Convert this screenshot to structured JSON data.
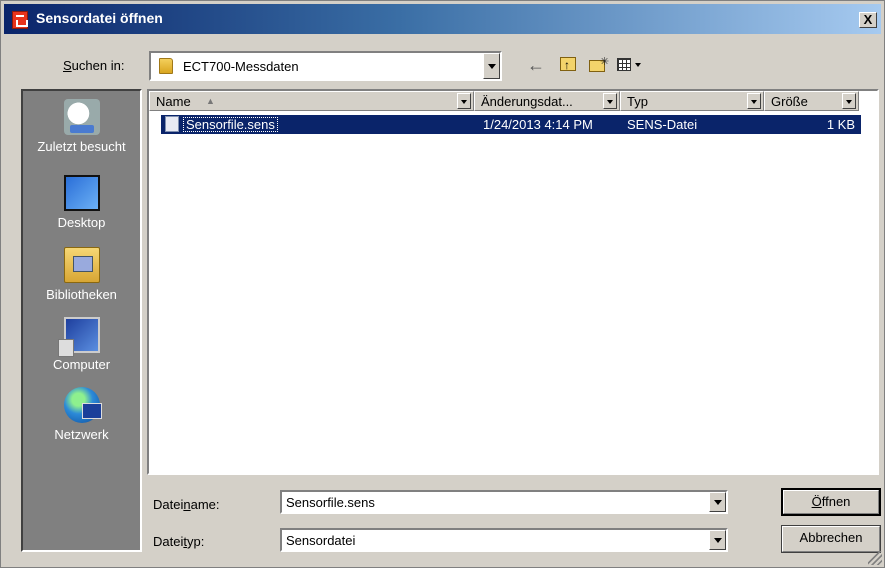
{
  "window": {
    "title": "Sensordatei öffnen",
    "close_label": "X"
  },
  "lookin": {
    "label_pre": "",
    "label_u": "S",
    "label_post": "uchen in:",
    "value": "ECT700-Messdaten"
  },
  "places": [
    {
      "label": "Zuletzt besucht",
      "icon": "recent-places-icon"
    },
    {
      "label": "Desktop",
      "icon": "desktop-icon"
    },
    {
      "label": "Bibliotheken",
      "icon": "libraries-icon"
    },
    {
      "label": "Computer",
      "icon": "computer-icon"
    },
    {
      "label": "Netzwerk",
      "icon": "network-icon"
    }
  ],
  "columns": {
    "name": "Name",
    "modified": "Änderungsdat...",
    "type": "Typ",
    "size": "Größe"
  },
  "files": [
    {
      "name": "Sensorfile.sens",
      "modified": "1/24/2013 4:14 PM",
      "type": "SENS-Datei",
      "size": "1 KB"
    }
  ],
  "filename": {
    "label_pre": "Datei",
    "label_u": "n",
    "label_post": "ame:",
    "value": "Sensorfile.sens"
  },
  "filetype": {
    "label_pre": "Datei",
    "label_u": "t",
    "label_post": "yp:",
    "value": "Sensordatei"
  },
  "buttons": {
    "open_u": "Ö",
    "open_post": "ffnen",
    "cancel": "Abbrechen"
  }
}
